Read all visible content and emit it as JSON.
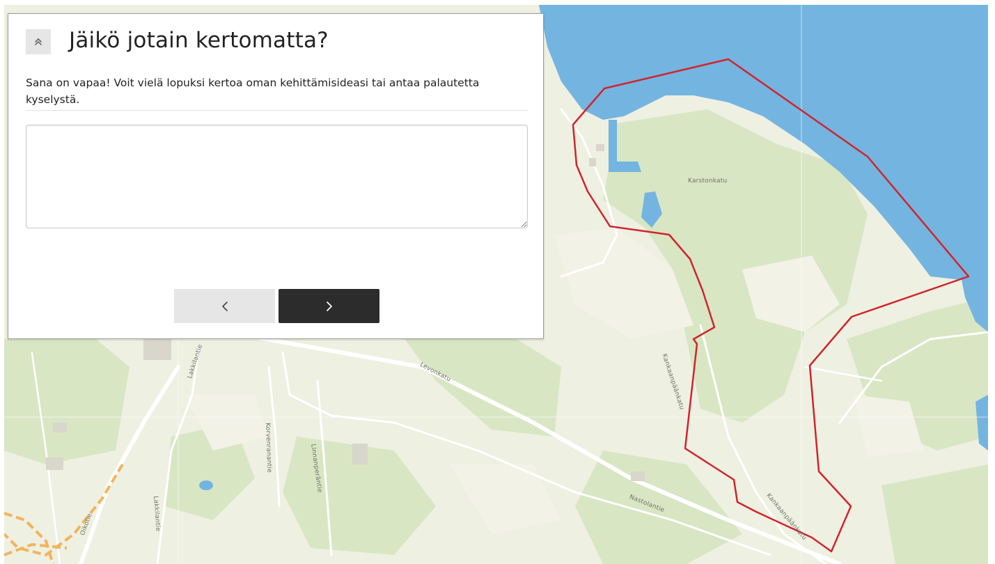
{
  "panel": {
    "collapse_icon": "double-chevron-up-icon",
    "collapse_glyph": "≫",
    "title": "Jäikö jotain kertomatta?",
    "description": "Sana on vapaa! Voit vielä lopuksi kertoa oman kehittämisideasi tai antaa palautetta kyselystä.",
    "feedback_value": "",
    "prev_icon": "chevron-left-icon",
    "next_icon": "chevron-right-icon"
  },
  "map": {
    "colors": {
      "land": "#eef0e2",
      "forest": "#d8e6c4",
      "water": "#74b4e0",
      "area_outline": "#d0242c",
      "road_main": "#ffffff",
      "road_dashed": "#f2b45a"
    },
    "street_labels": [
      "Karstonkatu",
      "Kankaanpäänkatu",
      "Kankaanpäänkatu",
      "Levonkatu",
      "Lakkilantie",
      "Korvenranantie",
      "Linnanperäntie",
      "Lakkilantie",
      "Nastolantie",
      "Oikotie"
    ]
  }
}
